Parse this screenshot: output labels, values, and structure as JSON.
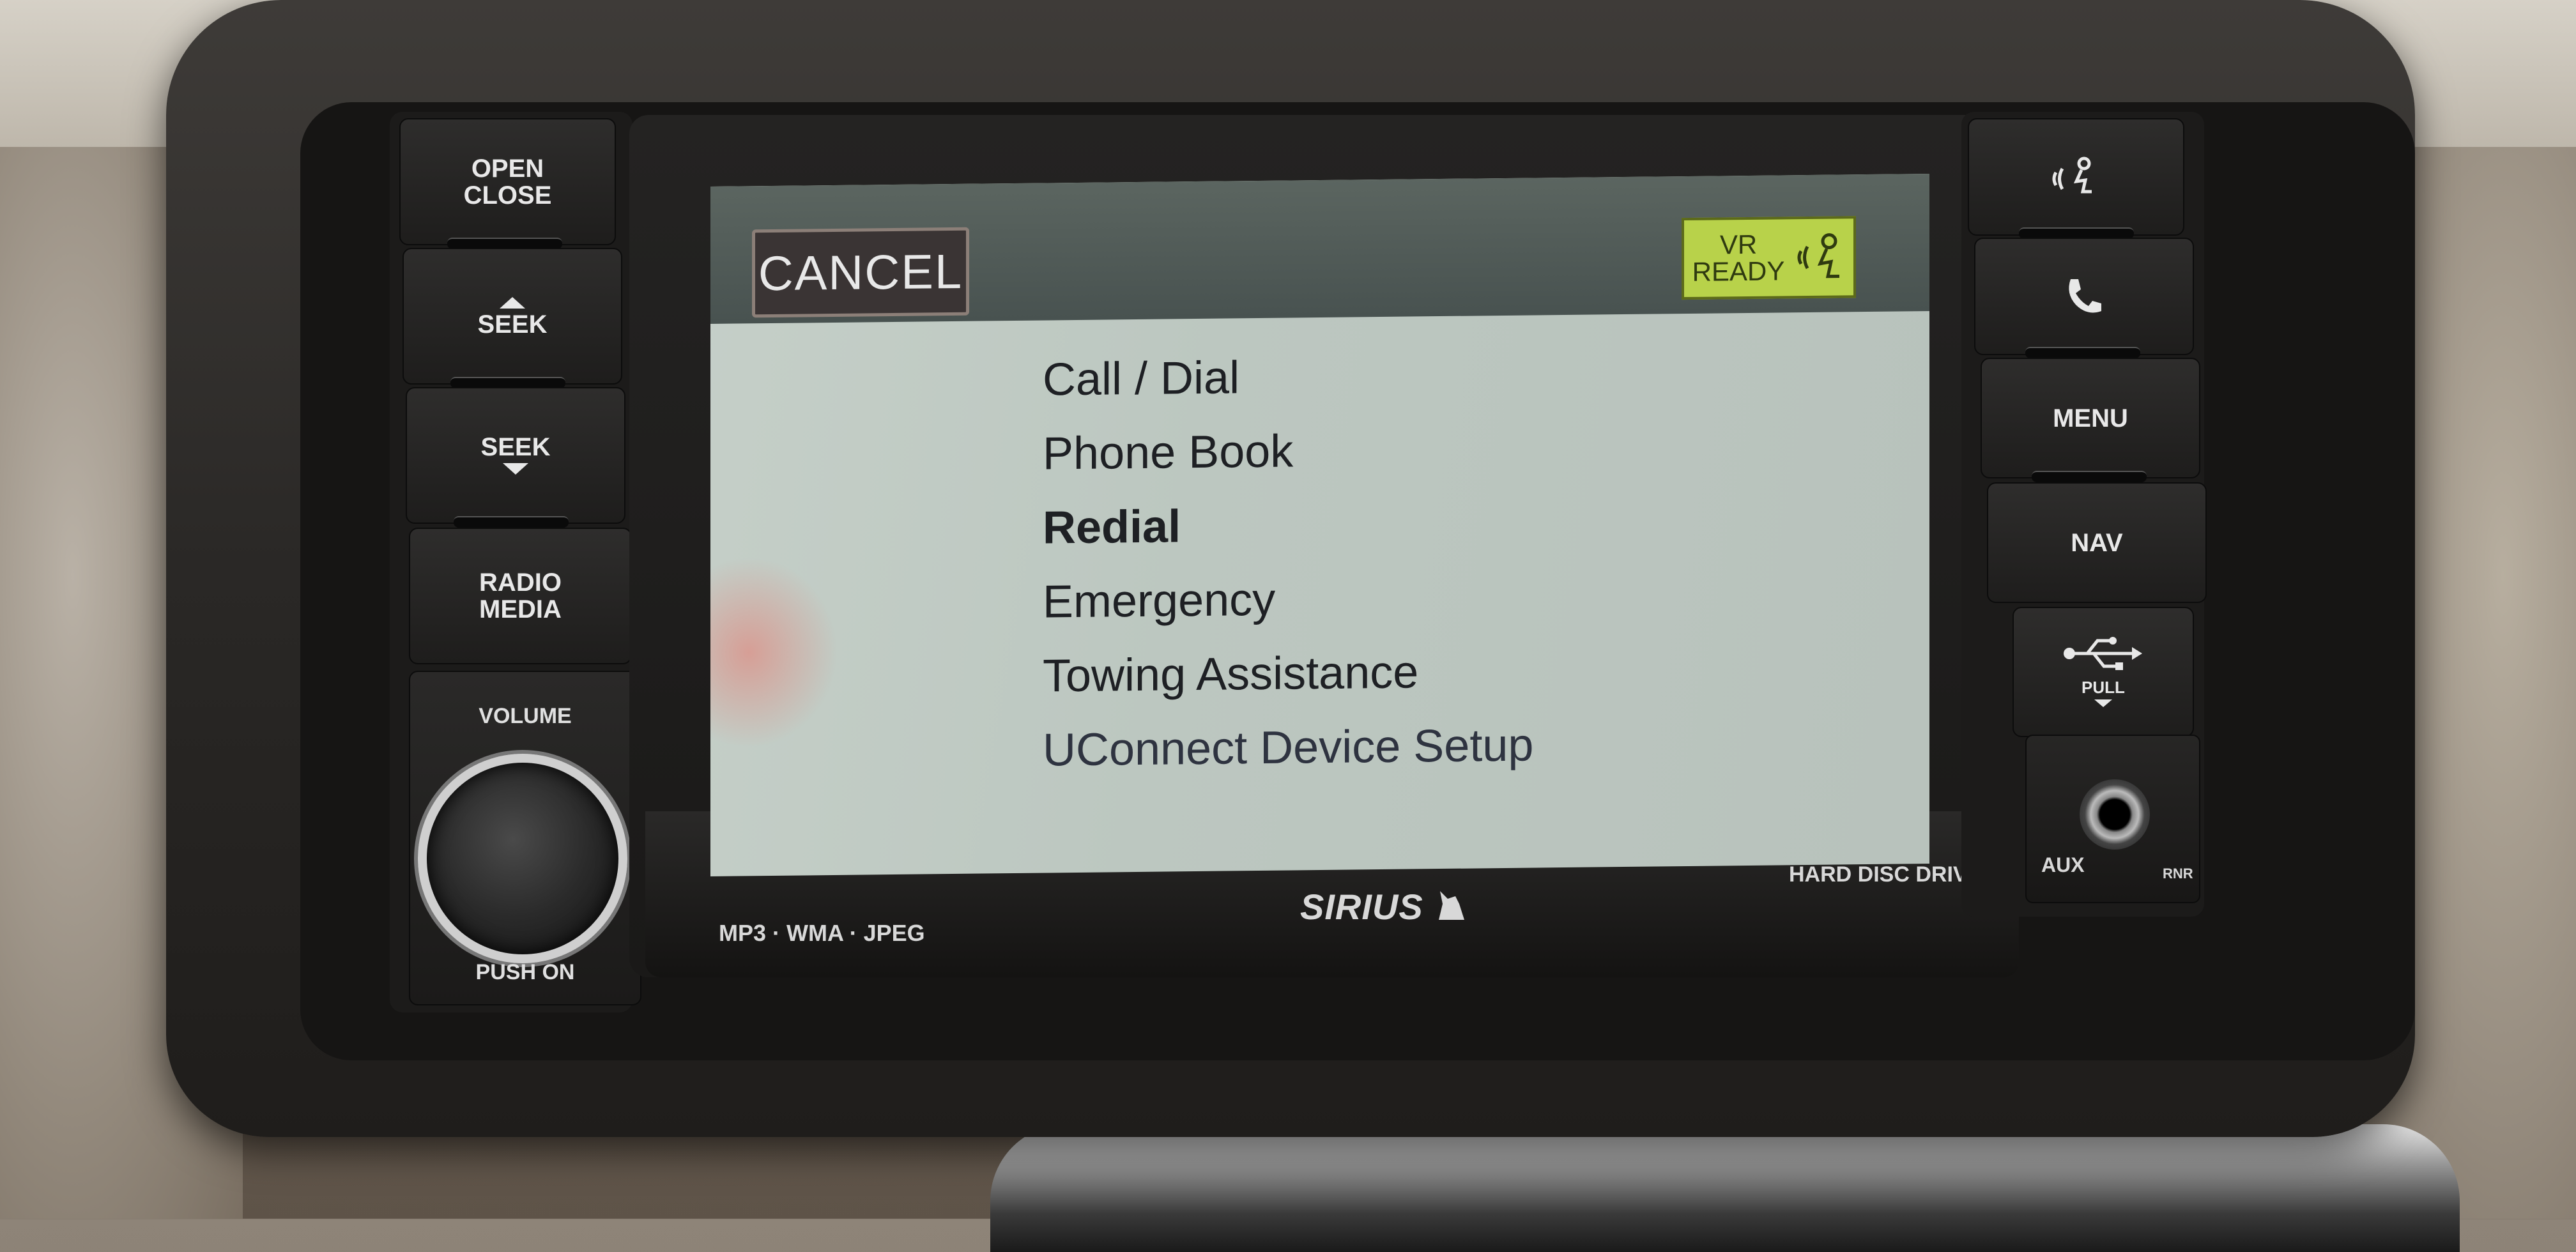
{
  "left_panel": {
    "open_close": "OPEN\nCLOSE",
    "seek_up": "SEEK",
    "seek_down": "SEEK",
    "radio_media": "RADIO\nMEDIA",
    "volume_label": "VOLUME",
    "push_on": "PUSH ON"
  },
  "screen": {
    "cancel_label": "CANCEL",
    "vr_badge": "VR\nREADY",
    "menu_items": [
      "Call / Dial",
      "Phone Book",
      "Redial",
      "Emergency",
      "Towing Assistance",
      "UConnect Device Setup"
    ],
    "highlighted_item": "Redial",
    "colors": {
      "screen_bg": "#c5cfc8",
      "header_bg": "#4e5855",
      "vr_badge_bg": "#b8d24a"
    }
  },
  "bezel_labels": {
    "formats": "MP3 · WMA · JPEG",
    "sirius": "SIRIUS",
    "hdd": "HARD DISC DRIVE"
  },
  "right_panel": {
    "voice_icon": "voice-command-icon",
    "phone_icon": "phone-icon",
    "menu": "MENU",
    "nav": "NAV",
    "usb_icon": "usb-icon",
    "pull": "PULL",
    "aux": "AUX",
    "rnr": "RNR"
  }
}
